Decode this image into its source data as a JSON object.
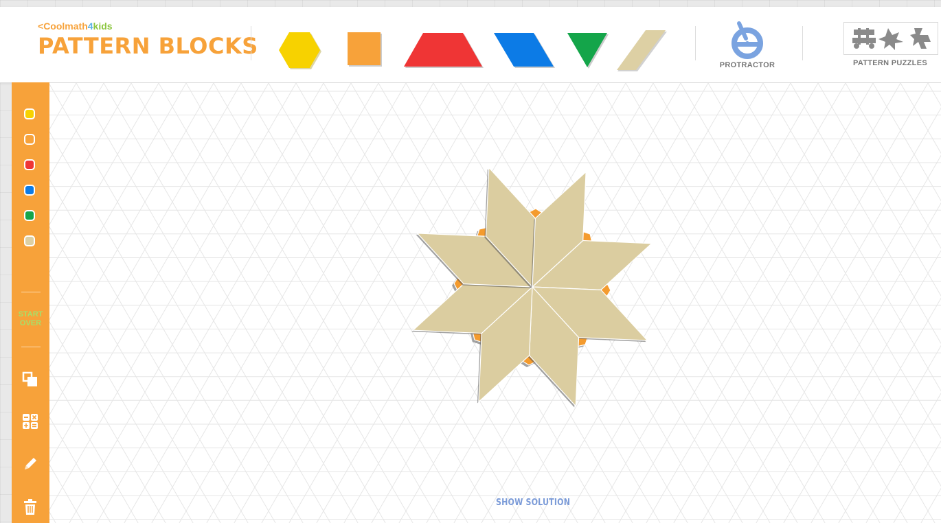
{
  "header": {
    "brand": {
      "prefix": "<",
      "part1": "Coolmath",
      "part2": "4",
      "part3": "kids"
    },
    "title": "PATTERN BLOCKS"
  },
  "toolbar": {
    "shapes": [
      {
        "name": "hexagon",
        "color": "#f7d200"
      },
      {
        "name": "square",
        "color": "#f7a23a"
      },
      {
        "name": "trapezoid",
        "color": "#ef3535"
      },
      {
        "name": "blue-rhombus",
        "color": "#0c7be6"
      },
      {
        "name": "triangle",
        "color": "#14a54a"
      },
      {
        "name": "tan-rhombus",
        "color": "#ddd0a4"
      }
    ],
    "protractor_label": "PROTRACTOR",
    "pattern_puzzles_label": "PATTERN PUZZLES"
  },
  "sidebar": {
    "color_swatches": [
      "#f7d200",
      "#f7a23a",
      "#ef3535",
      "#0c7be6",
      "#14a54a",
      "#ddd0a4"
    ],
    "start_over_line1": "START",
    "start_over_line2": "OVER",
    "icons": [
      "duplicate-icon",
      "calculator-icon",
      "pencil-icon",
      "trash-icon"
    ]
  },
  "canvas": {
    "show_solution_label": "SHOW SOLUTION",
    "tan_rhombus_color": "#dbcda0",
    "square_color": "#f49b2e"
  }
}
